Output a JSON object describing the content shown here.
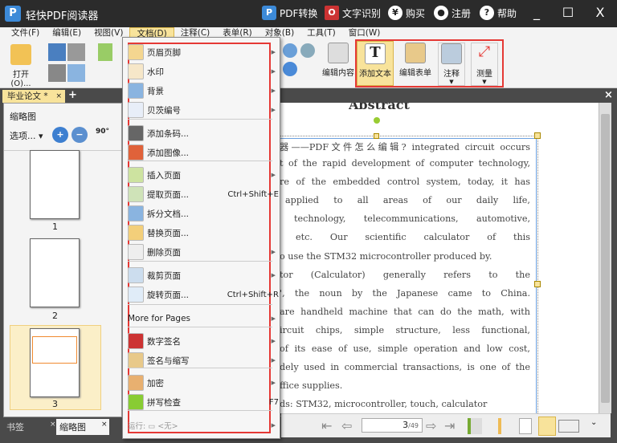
{
  "title": {
    "app": "轻快PDF阅读器",
    "logo": "P",
    "pdf_convert": "PDF转换",
    "ocr": "文字识别",
    "buy": "购买",
    "register": "注册",
    "help": "帮助",
    "minimize": "_",
    "maximize": "☐",
    "close": "X"
  },
  "menubar": [
    "文件(F)",
    "编辑(E)",
    "视图(V)",
    "文档(D)",
    "注释(C)",
    "表单(R)",
    "对象(B)",
    "工具(T)",
    "窗口(W)"
  ],
  "toolbar": {
    "open": "打开(O)...",
    "edit_content": "编辑内容",
    "add_text": "添加文本",
    "edit_form": "编辑表单",
    "annotate": "注释",
    "measure": "测量",
    "rotate": "90°"
  },
  "tabs": {
    "doc": "毕业论文 *",
    "close": "×",
    "add": "+",
    "close_all": "×"
  },
  "left_panel": {
    "title": "缩略图",
    "options": "选项...",
    "pages": [
      "1",
      "2",
      "3"
    ],
    "tab_bookmarks": "书签",
    "tab_thumbs": "缩略图"
  },
  "document": {
    "heading": "Abstract",
    "lines": [
      "器——PDF文件怎么编辑? integrated circuit occurs",
      "t of the rapid development of computer technology,",
      "re of the embedded control system, today, it has",
      "applied to all areas of our daily life,",
      "technology, telecommunications, automotive,",
      "etc. Our scientific calculator of this",
      "o use the STM32 microcontroller produced by.",
      "tor (Calculator) generally refers to the",
      "', the noun by the Japanese came to China.",
      "are handheld machine that can do the math, with",
      "ircuit chips, simple structure, less functional,",
      "of its ease of use, simple operation and low cost,",
      "dely used in commercial transactions, is one of the",
      "ffice supplies.",
      "ds: STM32, microcontroller, touch, calculator"
    ]
  },
  "nav": {
    "page": "3",
    "total": "/49"
  },
  "doc_menu": {
    "items": [
      {
        "label": "页眉页脚",
        "arrow": true
      },
      {
        "label": "水印",
        "arrow": true
      },
      {
        "label": "背景",
        "arrow": true
      },
      {
        "label": "贝茨编号",
        "arrow": true
      },
      {
        "label": "添加条码..."
      },
      {
        "label": "添加图像..."
      },
      {
        "label": "插入页面",
        "arrow": true
      },
      {
        "label": "提取页面...",
        "shortcut": "Ctrl+Shift+E"
      },
      {
        "label": "拆分文档..."
      },
      {
        "label": "替换页面..."
      },
      {
        "label": "删除页面",
        "arrow": true
      },
      {
        "label": "裁剪页面",
        "arrow": true
      },
      {
        "label": "旋转页面...",
        "shortcut": "Ctrl+Shift+R"
      },
      {
        "label": "More for Pages",
        "arrow": true
      },
      {
        "label": "数字签名",
        "arrow": true
      },
      {
        "label": "签名与缩写",
        "arrow": true
      },
      {
        "label": "加密",
        "arrow": true
      },
      {
        "label": "拼写检查",
        "shortcut": "F7"
      },
      {
        "label": "运行: ▭ <无>",
        "arrow": true
      }
    ]
  },
  "colors": {
    "highlight": "#e53935",
    "accent": "#f8e39b"
  }
}
